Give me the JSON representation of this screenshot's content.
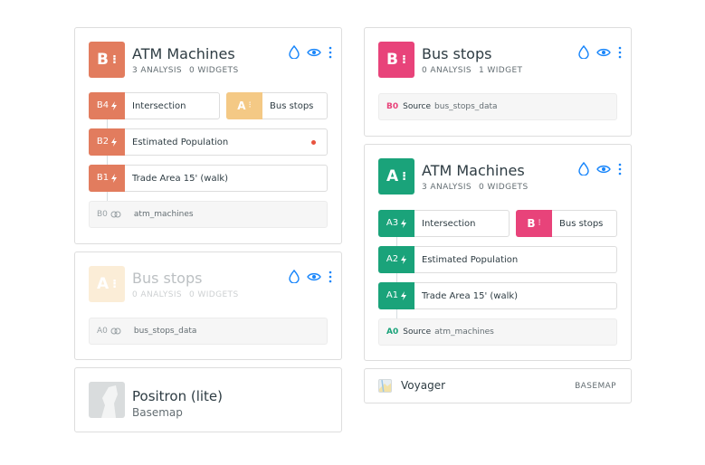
{
  "colors": {
    "orange": "#E27C5E",
    "orange_light": "#F4C985",
    "pink": "#E8437A",
    "green": "#1AA37A",
    "blue": "#1785FB",
    "error": "#E8533E"
  },
  "left": {
    "atm": {
      "letter": "B",
      "title": "ATM Machines",
      "analysis": "3 ANALYSIS",
      "widgets": "0 WIDGETS",
      "nodes": [
        {
          "id": "B4",
          "label": "Intersection"
        },
        {
          "id": "B2",
          "label": "Estimated Population"
        },
        {
          "id": "B1",
          "label": "Trade Area 15' (walk)"
        }
      ],
      "ref": {
        "letter": "A",
        "label": "Bus stops"
      },
      "source": {
        "id": "B0",
        "name": "atm_machines"
      }
    },
    "bus": {
      "letter": "A",
      "title": "Bus stops",
      "analysis": "0 ANALYSIS",
      "widgets": "0 WIDGETS",
      "source": {
        "id": "A0",
        "name": "bus_stops_data"
      }
    },
    "basemap": {
      "title": "Positron (lite)",
      "subtitle": "Basemap"
    }
  },
  "right": {
    "bus": {
      "letter": "B",
      "title": "Bus stops",
      "analysis": "0 ANALYSIS",
      "widgets": "1 WIDGET",
      "source": {
        "id": "B0",
        "keyword": "Source",
        "name": "bus_stops_data"
      }
    },
    "atm": {
      "letter": "A",
      "title": "ATM Machines",
      "analysis": "3 ANALYSIS",
      "widgets": "0 WIDGETS",
      "nodes": [
        {
          "id": "A3",
          "label": "Intersection"
        },
        {
          "id": "A2",
          "label": "Estimated Population"
        },
        {
          "id": "A1",
          "label": "Trade Area 15' (walk)"
        }
      ],
      "ref": {
        "letter": "B",
        "label": "Bus stops"
      },
      "source": {
        "id": "A0",
        "keyword": "Source",
        "name": "atm_machines"
      }
    },
    "basemap": {
      "title": "Voyager",
      "tag": "BASEMAP"
    }
  },
  "icons": [
    "style-drop-icon",
    "visibility-eye-icon",
    "more-options-icon",
    "lightning-icon",
    "source-link-icon",
    "basemap-thumbnail-icon"
  ]
}
